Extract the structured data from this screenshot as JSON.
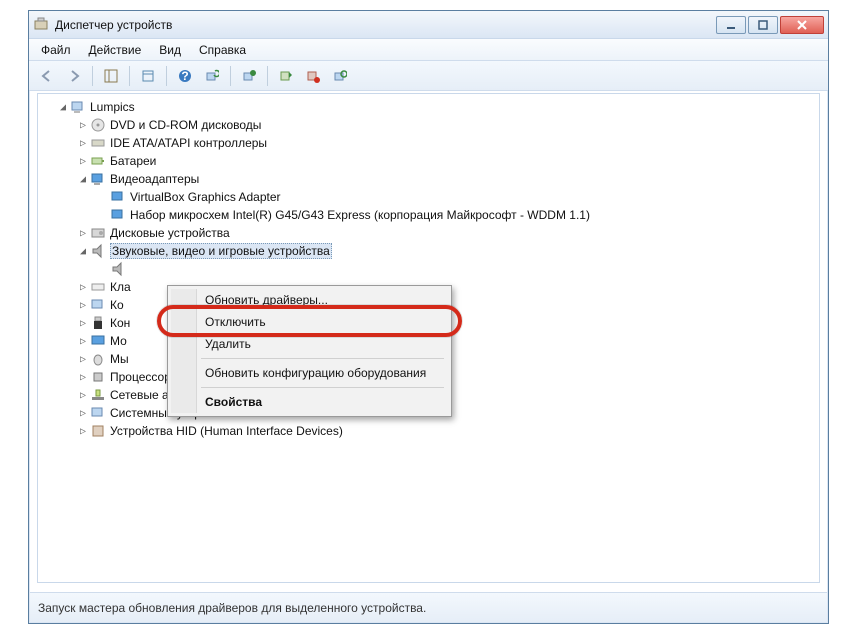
{
  "window": {
    "title": "Диспетчер устройств"
  },
  "menu": {
    "file": "Файл",
    "action": "Действие",
    "view": "Вид",
    "help": "Справка"
  },
  "tree": {
    "root": "Lumpics",
    "dvd": "DVD и CD-ROM дисководы",
    "ide": "IDE ATA/ATAPI контроллеры",
    "battery": "Батареи",
    "video": "Видеоадаптеры",
    "video_1": "VirtualBox Graphics Adapter",
    "video_2": "Набор микросхем Intel(R) G45/G43 Express (корпорация Майкрософт - WDDM 1.1)",
    "disk": "Дисковые устройства",
    "sound": "Звуковые, видео и игровые устройства",
    "keyboard": "Кла",
    "computer": "Ко",
    "controllers": "Кон",
    "monitors": "Мо",
    "mice": "Мы",
    "cpu": "Процессоры",
    "network": "Сетевые адаптеры",
    "system": "Системные устройства",
    "hid": "Устройства HID (Human Interface Devices)"
  },
  "context": {
    "update": "Обновить драйверы...",
    "disable": "Отключить",
    "uninstall": "Удалить",
    "scan": "Обновить конфигурацию оборудования",
    "properties": "Свойства"
  },
  "status": {
    "text": "Запуск мастера обновления драйверов для выделенного устройства."
  }
}
